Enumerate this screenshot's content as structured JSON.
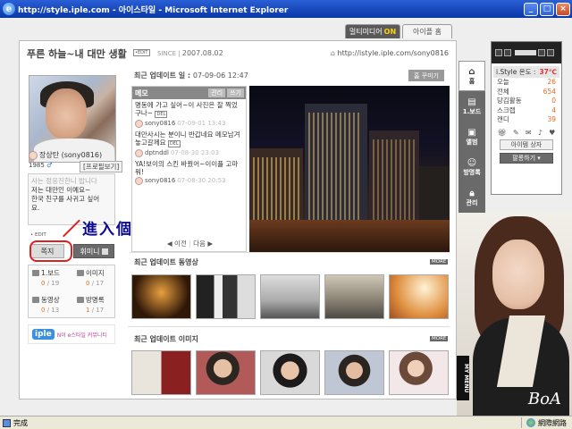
{
  "window": {
    "title": "http://style.iple.com - 아이스타일 - Microsoft Internet Explorer",
    "min_label": "_",
    "max_label": "□",
    "close_label": "×"
  },
  "tabs": [
    {
      "label": "멀티미디어",
      "badge": "ON"
    },
    {
      "label": "아이플 홈"
    }
  ],
  "blog": {
    "title": "푸른 하늘~내 대만 생활",
    "edit_tag": "•EDIT",
    "since_label": "SINCE",
    "since_date": "2007.08.02",
    "url": "http://istyle.iple.com/sony0816"
  },
  "profile": {
    "name": "장상탄 (sony0816)",
    "year": "1985",
    "gender_icon": "♂",
    "profile_button": "[프로필보기]",
    "intro_lines": [
      "사는 정응진한니 밥니다",
      "저는 대만인 이예요~",
      "한국 친구를 사귀고 싶어",
      "요."
    ],
    "intro_edit": "• EDIT",
    "note_button": "쪽지",
    "hmini_button": "휘미니"
  },
  "annotation": "進入個人收信箱",
  "stats": [
    {
      "icon": "board-icon",
      "label": "1.보드",
      "today": "0",
      "total": "19"
    },
    {
      "icon": "image-icon",
      "label": "이미지",
      "today": "0",
      "total": "17"
    },
    {
      "icon": "video-icon",
      "label": "동영상",
      "today": "0",
      "total": "13"
    },
    {
      "icon": "guestbook-icon",
      "label": "방명록",
      "today": "1",
      "total": "17"
    }
  ],
  "iple_banner": {
    "logo": "iple",
    "slogan": "N이 e스타일 커뮤니티"
  },
  "recent_update": {
    "label": "최근 업데이트 일 :",
    "value": "07-09-06 12:47"
  },
  "decorate_button": "홈 꾸미기",
  "memo": {
    "title": "메모",
    "manage": "관리",
    "write": "쓰기",
    "del_tag": "DEL",
    "items": [
      {
        "text": "명동에 가고 싶어~이 사진은 잘 찍었구나~",
        "user": "sony0816",
        "date": "07-09-01 13:43"
      },
      {
        "text": "대만사시는 분이니 반갑네요 메모남겨 놓고갈께요",
        "user": "dptnddl",
        "date": "07-08-30 23:03"
      },
      {
        "text": "YA!보이의 스킨 바꿨어~이이플 고마워!",
        "user": "sony0816",
        "date": "07-08-30 20:53"
      }
    ],
    "prev": "◀ 이전",
    "next": "다음 ▶"
  },
  "video_section": {
    "title": "최근 업데이트 동영상",
    "more": "MORE"
  },
  "image_section": {
    "title": "최근 업데이트 이미지",
    "more": "MORE"
  },
  "side_nav": [
    {
      "icon": "home-icon",
      "label": "홈",
      "active": true
    },
    {
      "icon": "board-icon",
      "label": "1.보드"
    },
    {
      "icon": "album-icon",
      "label": "앨범"
    },
    {
      "icon": "guestbook-icon",
      "label": "방명록"
    },
    {
      "icon": "admin-icon",
      "label": "관리"
    }
  ],
  "widget": {
    "temp_label": "i.Style 온도 :",
    "temp_value": "37℃",
    "rows": [
      {
        "label": "오늘",
        "value": "26"
      },
      {
        "label": "전체",
        "value": "654"
      },
      {
        "label": "당김활동",
        "value": "0"
      },
      {
        "label": "스크랩",
        "value": "4"
      },
      {
        "label": "캔디",
        "value": "39"
      }
    ],
    "icons": [
      "gift-icon",
      "note-icon",
      "message-icon",
      "bell-icon",
      "heart-icon"
    ],
    "box_button": "아이템 상자",
    "follow_button": "팔롱하기 ▾"
  },
  "promo": {
    "mymenu": "MY MENU",
    "brand": "BoA"
  },
  "status": {
    "done": "完成",
    "zone": "網際網路"
  }
}
